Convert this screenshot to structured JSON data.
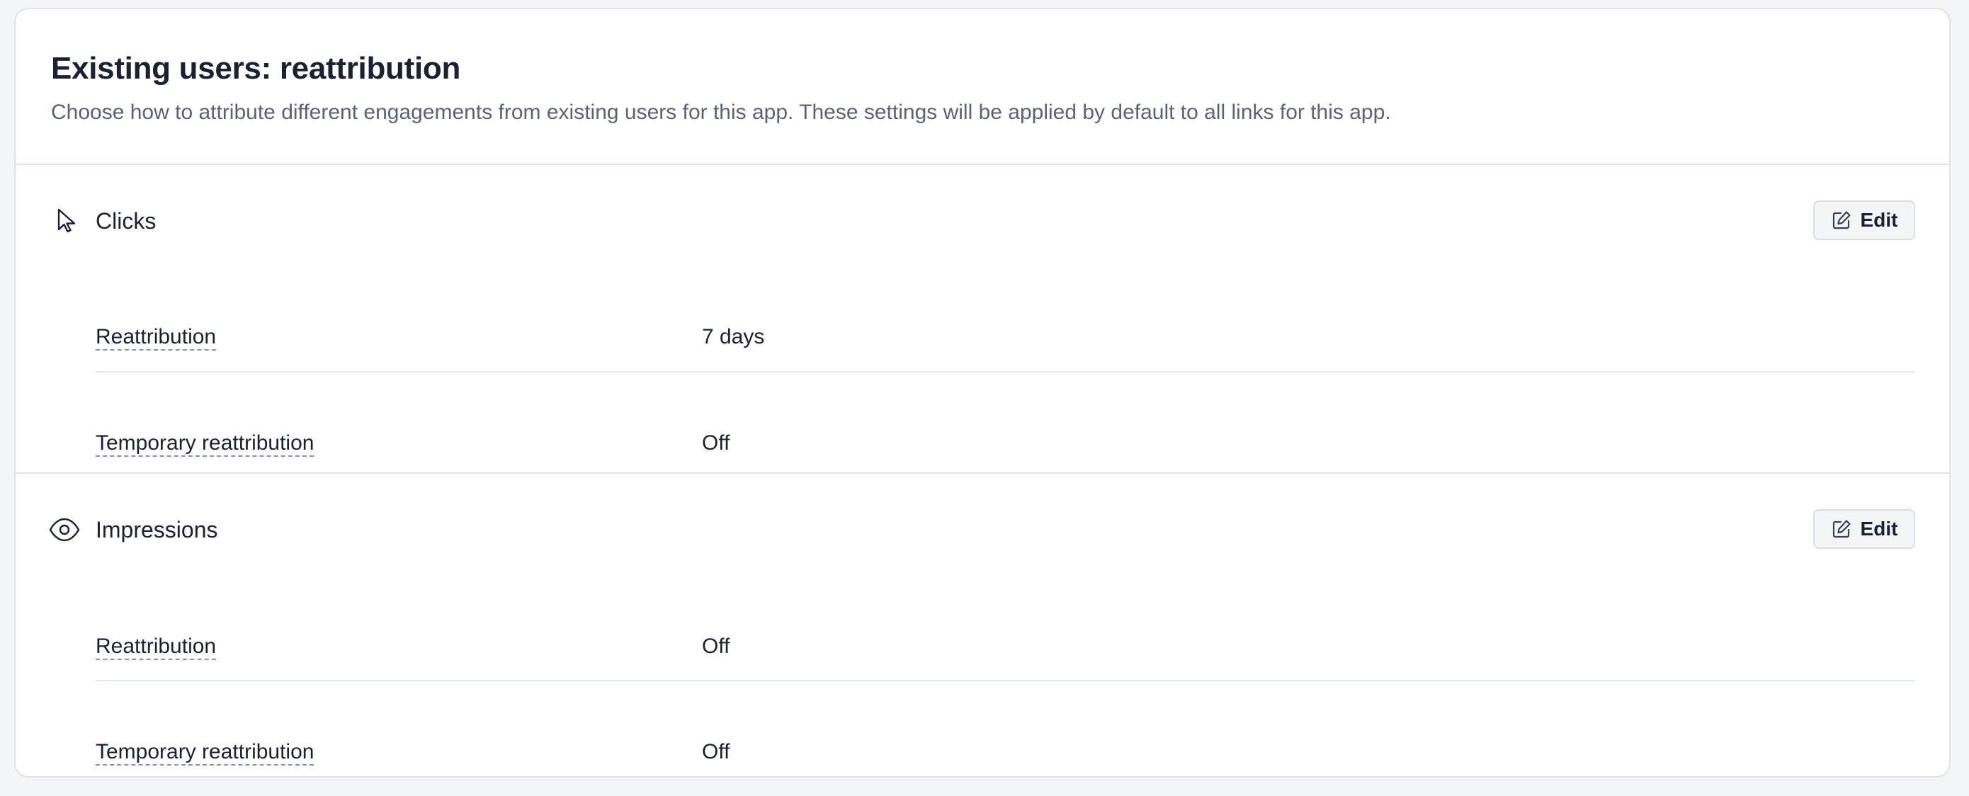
{
  "header": {
    "title": "Existing users: reattribution",
    "subtitle": "Choose how to attribute different engagements from existing users for this app. These settings will be applied by default to all links for this app."
  },
  "sections": [
    {
      "title": "Clicks",
      "icon": "cursor-arrow-icon",
      "edit_label": "Edit",
      "rows": [
        {
          "label": "Reattribution",
          "value": "7 days"
        },
        {
          "label": "Temporary reattribution",
          "value": "Off"
        }
      ]
    },
    {
      "title": "Impressions",
      "icon": "eye-icon",
      "edit_label": "Edit",
      "rows": [
        {
          "label": "Reattribution",
          "value": "Off"
        },
        {
          "label": "Temporary reattribution",
          "value": "Off"
        }
      ]
    }
  ],
  "colors": {
    "text_primary": "#1b2130",
    "text_secondary": "#5b6275",
    "border": "#e1e4e9",
    "button_bg": "#f4f5f7"
  }
}
